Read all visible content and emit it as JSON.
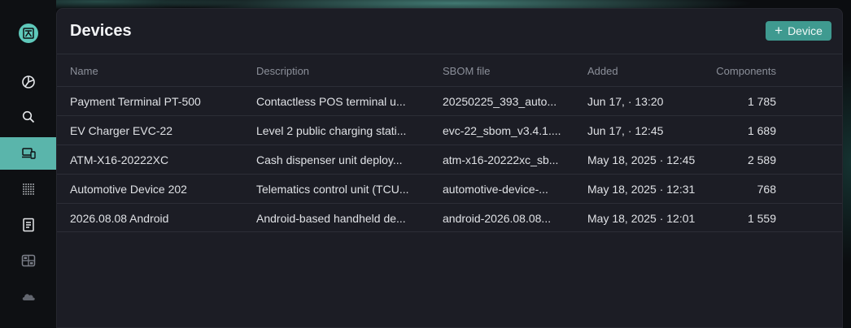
{
  "colors": {
    "accent": "#3f9a90",
    "nav_active": "#5ab5ab",
    "panel": "#1c1d25"
  },
  "sidebar": {
    "items": [
      {
        "icon": "dashboard-icon"
      },
      {
        "icon": "search-icon"
      },
      {
        "icon": "devices-icon",
        "active": true
      },
      {
        "icon": "dots-grid-icon"
      },
      {
        "icon": "document-icon"
      },
      {
        "icon": "components-icon"
      },
      {
        "icon": "cloud-icon"
      }
    ]
  },
  "header": {
    "title": "Devices",
    "add_button_label": "Device"
  },
  "table": {
    "columns": [
      "Name",
      "Description",
      "SBOM file",
      "Added",
      "Components"
    ],
    "rows": [
      {
        "name": "Payment Terminal PT-500",
        "description": "Contactless POS terminal u...",
        "sbom": "20250225_393_auto...",
        "added": "Jun 17, · 13:20",
        "components": "1 785"
      },
      {
        "name": "EV Charger EVC-22",
        "description": "Level 2 public charging stati...",
        "sbom": "evc-22_sbom_v3.4.1....",
        "added": "Jun 17, · 12:45",
        "components": "1 689"
      },
      {
        "name": "ATM-X16-20222XC",
        "description": "Cash dispenser unit deploy...",
        "sbom": "atm-x16-20222xc_sb...",
        "added": "May 18, 2025 · 12:45",
        "components": "2 589"
      },
      {
        "name": "Automotive Device 202",
        "description": "Telematics control unit (TCU...",
        "sbom": "automotive-device-...",
        "added": "May 18, 2025 · 12:31",
        "components": "768"
      },
      {
        "name": "2026.08.08 Android",
        "description": "Android-based handheld de...",
        "sbom": "android-2026.08.08...",
        "added": "May 18, 2025 · 12:01",
        "components": "1 559"
      }
    ]
  }
}
